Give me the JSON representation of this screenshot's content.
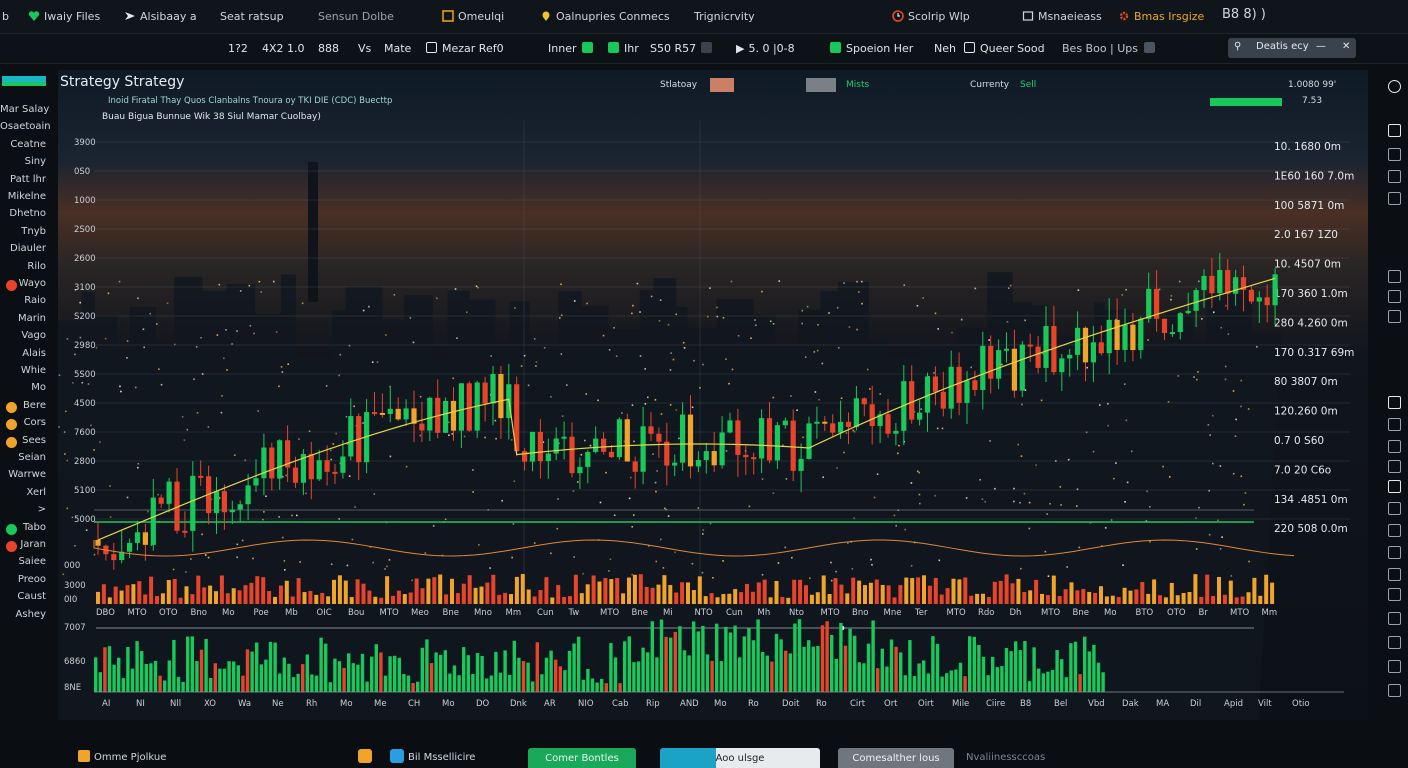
{
  "colors": {
    "accent": "#18c85a",
    "bear": "#e8442a",
    "orange": "#f0a52a",
    "cyan": "#19b6c8",
    "bg": "#0b0f14"
  },
  "topbar": {
    "items": [
      {
        "label": "b",
        "icon": "none"
      },
      {
        "label": "Iwaiy Files",
        "icon": "heart-icon"
      },
      {
        "label": "Alsibaay a",
        "icon": "arrow-icon"
      },
      {
        "label": "Seat ratsup",
        "icon": "none"
      },
      {
        "label": "Sensun Dolbe",
        "icon": "none"
      },
      {
        "label": "Omeulqi",
        "icon": "square-icon"
      },
      {
        "label": "Oalnupries Conmecs",
        "icon": "pin-icon"
      },
      {
        "label": "Trignicrvity",
        "icon": "none"
      },
      {
        "label": "Scolrip Wlp",
        "icon": "clock-icon"
      },
      {
        "label": "Msnaeieass",
        "icon": "box-icon"
      },
      {
        "label": "Bmas Irsgize",
        "icon": "gear-icon"
      },
      {
        "label": "B8 8) )",
        "icon": "none"
      }
    ]
  },
  "toolbar": {
    "items": [
      "1?2",
      "4X2 1.0",
      "888",
      "Vs",
      "Mate",
      "Mezar Ref0",
      "Inner",
      "Ihr",
      "S50 R57",
      "5. 0 |0-8",
      "Spoeion Her",
      "Neh",
      "Queer Sood",
      "Bes  Boo | Ups"
    ],
    "search_label": "Deatis ecy"
  },
  "panel": {
    "title": "Strategy   Strategy",
    "subtitle": "Inoid Firatal Thay Quos Clanbalns Tnoura oy TKI DIE (CDC) Buecttp",
    "legend": "Buau Bigua Bunnue   Wik 38 Siul Mamar   Cuolbay)",
    "hdr_strategy": "Stlatoay",
    "hdr_mists": "Mists",
    "hdr_currently": "Currenty",
    "hdr_ext": "Sell",
    "hdr_right": "1.0080 99'",
    "hdr_right_val": "7.53"
  },
  "sidebar": {
    "items": [
      "Mar Salay",
      "Osaetoaing",
      "Ceatne",
      "Siny",
      "Patt lhr",
      "Mikelne",
      "Dhetno",
      "Tnyb",
      "Diauler",
      "Rilo",
      "Wayo",
      "Raio",
      "Marin",
      "Vago",
      "Alais",
      "Whie",
      "Mo",
      "Bere",
      "Cors",
      "Sees",
      "Seian",
      "Warrwe",
      "Xerl",
      ">",
      "Tabo",
      "Jaran",
      "Saiee",
      "Preoo",
      "Caust",
      "Ashey"
    ]
  },
  "chart_data": {
    "type": "candlestick",
    "y_axis_labels": [
      "3900",
      "0S0",
      "1000",
      "2S00",
      "2600",
      "3100",
      "S200",
      "2980",
      "5S00",
      "4500",
      "7600",
      "2800",
      "5100",
      "5000"
    ],
    "right_price_labels": [
      "10. 1680 0m",
      "1E60 160 7.0m",
      "100 5871 0m",
      "2.0 167 1Z0",
      "10. 4507 0m",
      "170 360 1.0m",
      "280 4.260 0m",
      "170 0.317 69m",
      "80 3807 0m",
      "120.260 0m",
      "0.7 0 S60",
      "7.0 20 C6o",
      "134 .4851 0m",
      "220 508 0.0m"
    ],
    "volume_y_labels": [
      "000",
      "3000",
      "0I0",
      "7007",
      "6860",
      "8NE"
    ],
    "x_labels_upper": [
      "DBO",
      "MTO",
      "OTO",
      "Bno",
      "Mo",
      "Poe",
      "Mb",
      "OIC",
      "Bou",
      "MTO",
      "Meo",
      "Bne",
      "Mno",
      "Mm",
      "Cun",
      "Tw",
      "MTO",
      "Bne",
      "Mi",
      "NTO",
      "Cun",
      "Mh",
      "Nto",
      "MTO",
      "Bno",
      "Mne",
      "Ter",
      "MTO",
      "Rdo",
      "Dh",
      "MTO",
      "Bne",
      "Mo",
      "BTO",
      "OTO",
      "Br",
      "MTO",
      "Mm"
    ],
    "x_labels_lower": [
      "AI",
      "NI",
      "Nll",
      "XO",
      "Wa",
      "Ne",
      "Rh",
      "Mo",
      "Me",
      "CH",
      "Mo",
      "DO",
      "Dnk",
      "AR",
      "NIO",
      "Cab",
      "Rip",
      "AND",
      "Mo",
      "Ro",
      "Doit",
      "Ro",
      "Cirt",
      "Ort",
      "Oirt",
      "Mile",
      "Ciire",
      "B8",
      "Bel",
      "Vbd",
      "Dak",
      "MA",
      "Dil",
      "Apid",
      "Vilt",
      "Otio"
    ]
  },
  "bottombar": {
    "left_label": "Omme Pjolkue",
    "mid_label": "Bil Mssellicire",
    "btn_green": "Comer Bontles",
    "btn_cyan": "Aoo ulsge",
    "btn_gray": "Comesalther lous",
    "right_label": "Nvaliinessccoas"
  }
}
